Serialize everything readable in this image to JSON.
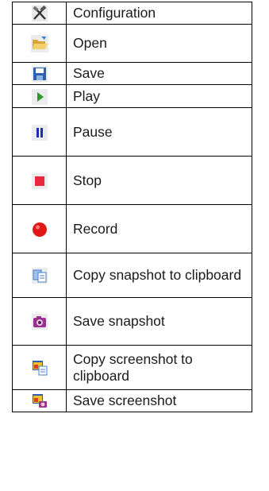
{
  "legend": {
    "rows": [
      {
        "icon": "configuration-icon",
        "label": "Configuration"
      },
      {
        "icon": "open-folder-icon",
        "label": "Open"
      },
      {
        "icon": "save-disk-icon",
        "label": "Save"
      },
      {
        "icon": "play-icon",
        "label": "Play"
      },
      {
        "icon": "pause-icon",
        "label": "Pause"
      },
      {
        "icon": "stop-icon",
        "label": "Stop"
      },
      {
        "icon": "record-icon",
        "label": "Record"
      },
      {
        "icon": "copy-snapshot-icon",
        "label": "Copy snapshot to clipboard"
      },
      {
        "icon": "save-snapshot-icon",
        "label": "Save snapshot"
      },
      {
        "icon": "copy-screenshot-icon",
        "label": "Copy screenshot to clipboard"
      },
      {
        "icon": "save-screenshot-icon",
        "label": "Save screenshot"
      }
    ]
  },
  "colors": {
    "play": "#2e9a2e",
    "pause": "#1c2fb0",
    "stop": "#e8283c",
    "record": "#e01818",
    "folder": "#f2c24f",
    "disk": "#2f5fb0",
    "camera": "#9a2f8f"
  }
}
